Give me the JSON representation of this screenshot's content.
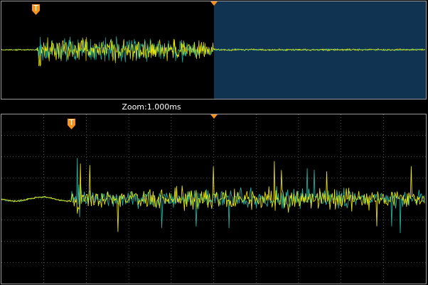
{
  "colors": {
    "background": "#000000",
    "zoom_window": "#0f3350",
    "frame": "#9a9a9a",
    "grid": "#8a8a8a",
    "trace_yellow": "#f2e600",
    "trace_cyan": "#1fb7a8",
    "marker": "#f7931e"
  },
  "overview": {
    "trigger_marker_label": "T",
    "zoom_window_fraction": [
      0.5,
      1.0
    ]
  },
  "zoom": {
    "label": "Zoom:1.000ms",
    "trigger_marker_label": "T",
    "grid_divisions": {
      "x": 10,
      "y": 8
    }
  },
  "icons": [
    "trigger-marker-icon",
    "horizontal-position-marker-icon"
  ]
}
